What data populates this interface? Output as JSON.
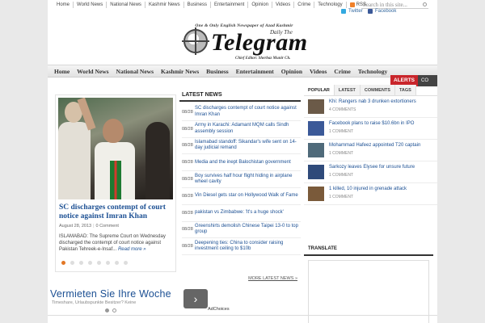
{
  "topnav": {
    "items": [
      "Home",
      "World News",
      "National News",
      "Kashmir News",
      "Business",
      "Entertainment",
      "Opinion",
      "Videos",
      "Crime",
      "Technology"
    ],
    "rss_label": "RSS",
    "search_placeholder": "Search in this site...",
    "twitter_label": "Twitter",
    "facebook_label": "Facebook"
  },
  "masthead": {
    "tagline": "One & Only English Newspaper of Azad Kashmir",
    "daily_the": "Daily The",
    "logo": "Telegram",
    "editor": "Chief Editor: Sherbaz Munir Ch."
  },
  "mainnav": {
    "items": [
      "Home",
      "World News",
      "National News",
      "Kashmir News",
      "Business",
      "Entertainment",
      "Opinion",
      "Videos",
      "Crime",
      "Technology"
    ]
  },
  "alerts": {
    "label": "ALERTS",
    "ticker": "CO"
  },
  "featured": {
    "title": "SC discharges contempt of court notice against Imran Khan",
    "date": "August 28, 2013",
    "comments": "0 Comment",
    "excerpt": "ISLAMABAD: The Supreme Court on Wednesday discharged the contempt of court notice against Pakistan Tehreek-e-Insaf...",
    "read_more": "Read more »",
    "slides": 8,
    "active_slide": 1
  },
  "latest_news": {
    "heading": "LATEST NEWS",
    "items": [
      {
        "date": "08/28",
        "title": "SC discharges contempt of court notice against Imran Khan"
      },
      {
        "date": "08/28",
        "title": "Army in Karachi: Adamant MQM calls Sindh assembly session"
      },
      {
        "date": "08/28",
        "title": "Islamabad standoff: Sikandar's wife sent on 14-day judicial remand"
      },
      {
        "date": "08/28",
        "title": "Media and the inept Balochistan government"
      },
      {
        "date": "08/28",
        "title": "Boy survives half hour flight hiding in airplane wheel cavity"
      },
      {
        "date": "08/28",
        "title": "Vin Diesel gets star on Hollywood Walk of Fame"
      },
      {
        "date": "08/28",
        "title": "pakistan vs Zimbabwe: 'It's a huge shock'"
      },
      {
        "date": "08/28",
        "title": "Greenshirts demolish Chinese Taipei 13-0 to top group"
      },
      {
        "date": "08/28",
        "title": "Deepening ties: China to consider raising investment ceiling to $10b"
      }
    ],
    "more_label": "MORE LATEST NEWS »"
  },
  "sidebar": {
    "tabs": [
      "POPULAR",
      "LATEST",
      "COMMENTS",
      "TAGS"
    ],
    "popular": [
      {
        "title": "Khi: Rangers nab 3 drunken extortioners",
        "count": "4 COMMENTS",
        "color": "#6b5a48"
      },
      {
        "title": "Facebook plans to raise $10.6bn in IPO",
        "count": "1 COMMENT",
        "color": "#3b5998"
      },
      {
        "title": "Mohammad Hafeez appointed T20 captain",
        "count": "1 COMMENT",
        "color": "#4f6a7a"
      },
      {
        "title": "Sarkozy leaves Elysee for unsure future",
        "count": "1 COMMENT",
        "color": "#2f4a7a"
      },
      {
        "title": "1 killed, 10 injured in grenade attack",
        "count": "1 COMMENT",
        "color": "#7a5a3a"
      }
    ],
    "translate_heading": "TRANSLATE"
  },
  "ad": {
    "title": "Vermieten Sie Ihre Woche",
    "subtitle": "Timeshare, Urlaubspunkte Besitzer? Keine",
    "adchoices": "AdChoices"
  },
  "colors": {
    "link": "#1b4f93",
    "alert": "#c9252b",
    "accent_dot": "#e27725"
  }
}
